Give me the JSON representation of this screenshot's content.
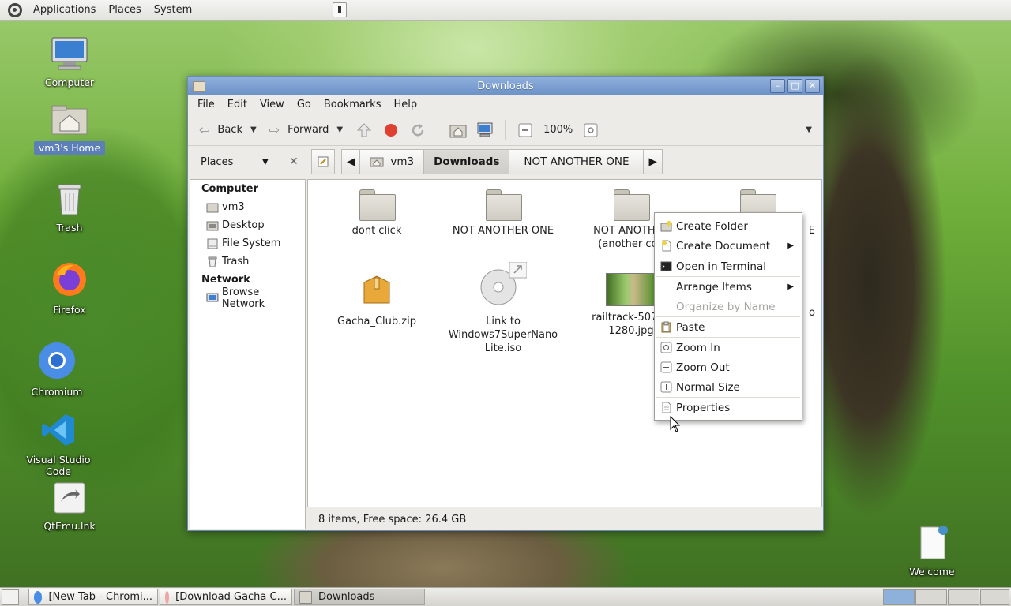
{
  "panel": {
    "menus": [
      "Applications",
      "Places",
      "System"
    ]
  },
  "desktop_icons": [
    {
      "label": "Computer"
    },
    {
      "label": "vm3's Home"
    },
    {
      "label": "Trash"
    },
    {
      "label": "Firefox"
    },
    {
      "label": "Chromium"
    },
    {
      "label": "Visual Studio Code"
    },
    {
      "label": "QtEmu.lnk"
    },
    {
      "label": "Welcome"
    }
  ],
  "window": {
    "title": "Downloads",
    "menubar": [
      "File",
      "Edit",
      "View",
      "Go",
      "Bookmarks",
      "Help"
    ],
    "toolbar": {
      "back_label": "Back",
      "forward_label": "Forward",
      "zoom_level": "100%"
    },
    "location": {
      "places_label": "Places",
      "path": [
        "vm3",
        "Downloads",
        "NOT ANOTHER ONE"
      ]
    },
    "sidebar": {
      "computer_header": "Computer",
      "computer_items": [
        "vm3",
        "Desktop",
        "File System",
        "Trash"
      ],
      "network_header": "Network",
      "network_items": [
        "Browse Network"
      ]
    },
    "files": [
      {
        "name": "dont click",
        "type": "folder"
      },
      {
        "name": "NOT ANOTHER ONE",
        "type": "folder"
      },
      {
        "name": "NOT ANOTHER",
        "name2": "(another cop",
        "type": "folder"
      },
      {
        "name": "E",
        "type": "folder"
      },
      {
        "name": "Gacha_Club.zip",
        "type": "archive"
      },
      {
        "name": "Link to",
        "name2": "Windows7SuperNano",
        "name3": "Lite.iso",
        "type": "disc-link"
      },
      {
        "name": "railtrack-50745",
        "name2": "1280.jpg",
        "type": "image"
      },
      {
        "name": "o",
        "type": "file"
      }
    ],
    "status": "8 items, Free space: 26.4 GB"
  },
  "context_menu": {
    "items": [
      {
        "label": "Create Folder",
        "enabled": true
      },
      {
        "label": "Create Document",
        "enabled": true,
        "submenu": true
      },
      {
        "label": "Open in Terminal",
        "enabled": true
      },
      {
        "label": "Arrange Items",
        "enabled": true,
        "submenu": true
      },
      {
        "label": "Organize by Name",
        "enabled": false
      },
      {
        "label": "Paste",
        "enabled": true
      },
      {
        "label": "Zoom In",
        "enabled": true
      },
      {
        "label": "Zoom Out",
        "enabled": true
      },
      {
        "label": "Normal Size",
        "enabled": true
      },
      {
        "label": "Properties",
        "enabled": true
      }
    ]
  },
  "taskbar": {
    "tasks": [
      "[New Tab - Chromi...",
      "[Download Gacha C...",
      "Downloads"
    ]
  },
  "colors": {
    "titlebar": "#6b91c8",
    "selection": "#5c7fb8",
    "stop_red": "#e04030"
  }
}
